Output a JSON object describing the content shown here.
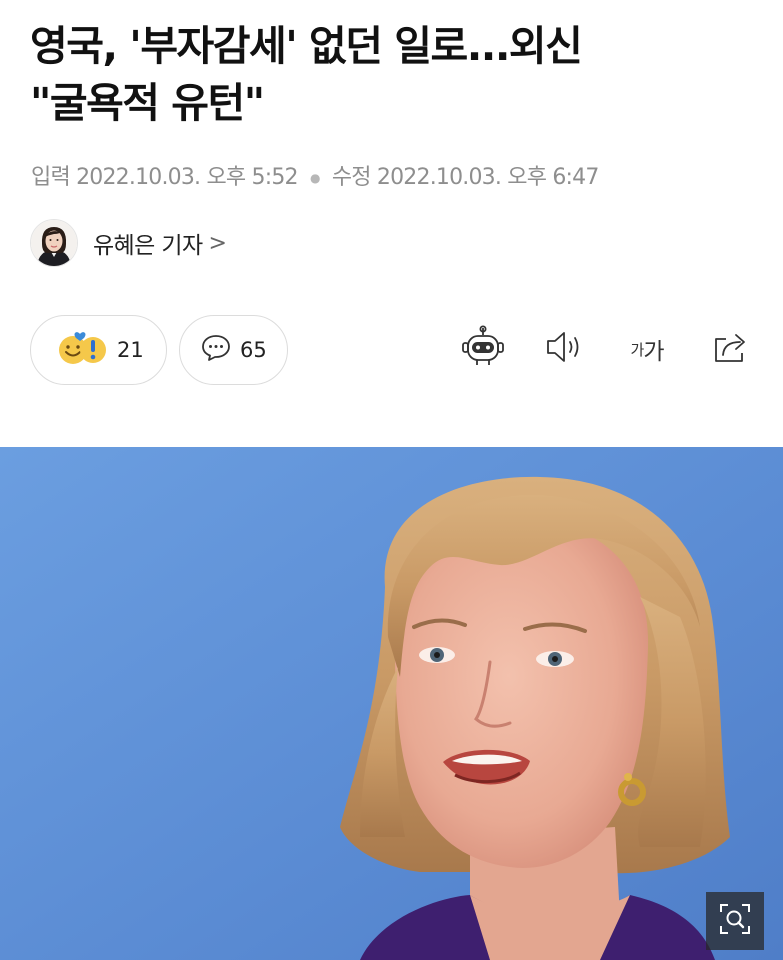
{
  "article": {
    "title_line1": "영국, '부자감세' 없던 일로...외신",
    "title_line2": "\"굴욕적 유턴\"",
    "input_label": "입력",
    "input_time": "2022.10.03. 오후 5:52",
    "modified_label": "수정",
    "modified_time": "2022.10.03. 오후 6:47",
    "author_name": "유혜은 기자",
    "author_chevron": ">"
  },
  "reactions": {
    "count": "21"
  },
  "comments": {
    "count": "65"
  },
  "toolbar": {
    "font_small": "가",
    "font_large": "가",
    "icons": [
      "robot-summary-icon",
      "speaker-icon",
      "font-size-icon",
      "share-icon"
    ]
  },
  "photo": {
    "zoom_icon": "magnifier-icon"
  },
  "colors": {
    "photo_background": "#5d8ed4",
    "muted_text": "#8e8e8e"
  }
}
